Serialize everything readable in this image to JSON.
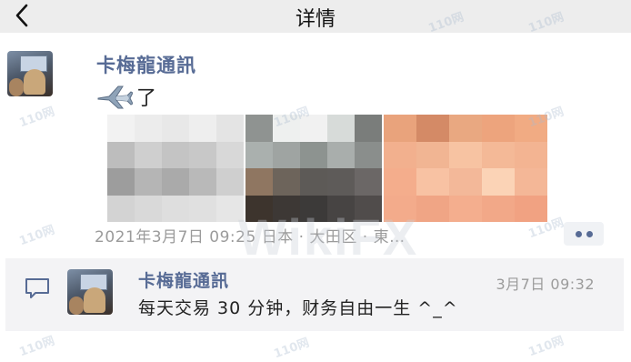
{
  "nav": {
    "title": "详情",
    "back_icon": "chevron-left-icon"
  },
  "post": {
    "author": "卡梅龍通訊",
    "text": "了",
    "text_icon": "airplane-emoji-icon",
    "meta": "2021年3月7日 09:25 日本 · 大田区 · 東…"
  },
  "comment": {
    "author": "卡梅龍通訊",
    "time": "3月7日 09:32",
    "text": "每天交易 30 分钟，财务自由一生 ^_^"
  },
  "watermarks": {
    "small": "110网",
    "big": "WikiFX"
  },
  "colors": {
    "name_blue": "#576b95",
    "meta_gray": "#9b9b9b",
    "nav_bg": "#ededed",
    "comment_bg": "#f3f3f5"
  }
}
